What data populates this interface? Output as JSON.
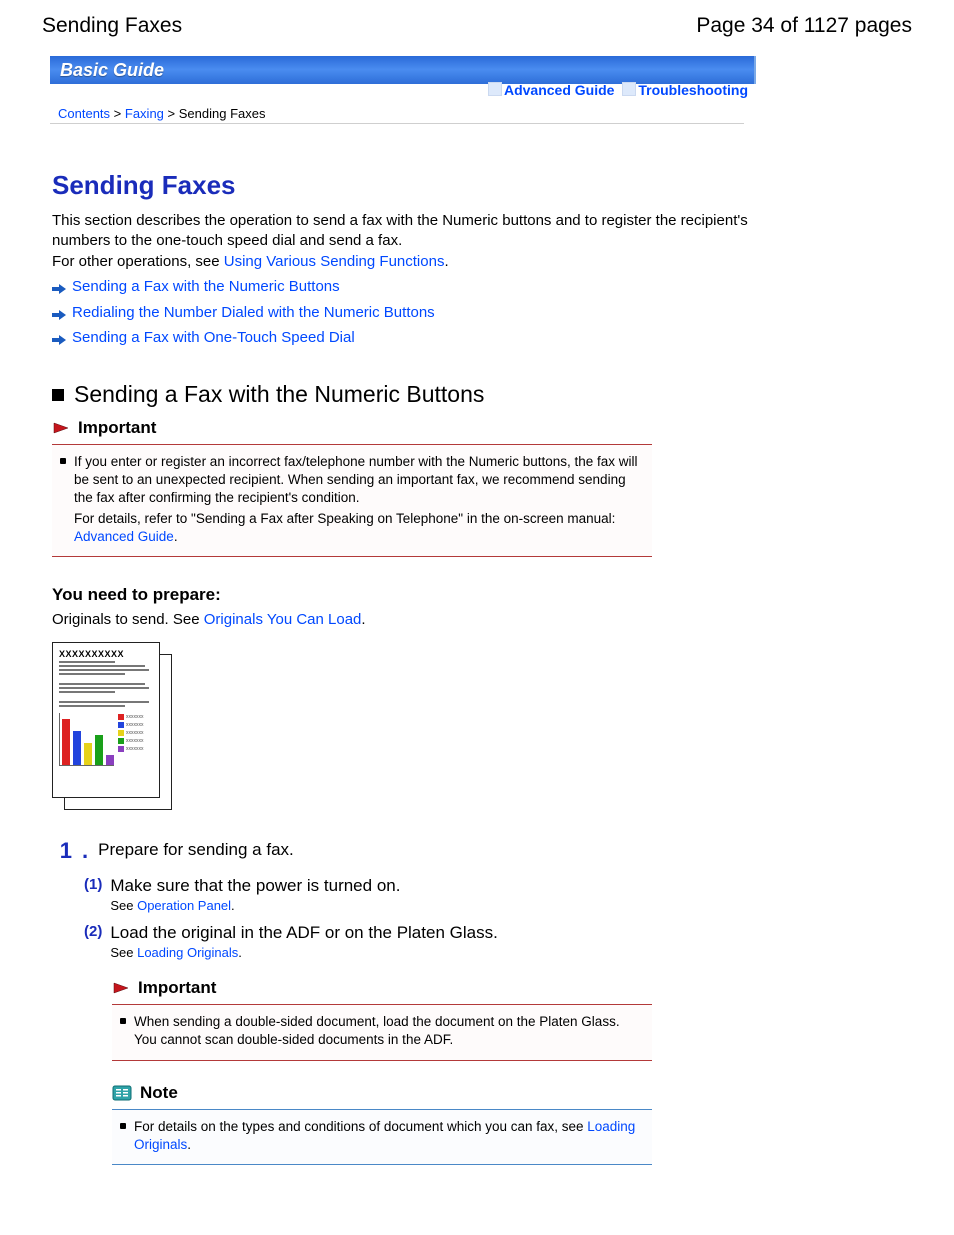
{
  "header": {
    "title_left": "Sending Faxes",
    "title_right": "Page 34 of 1127 pages"
  },
  "banner": {
    "title": "Basic Guide",
    "advanced": "Advanced Guide",
    "troubleshooting": "Troubleshooting"
  },
  "breadcrumb": {
    "contents": "Contents",
    "faxing": "Faxing",
    "current": "Sending Faxes"
  },
  "main": {
    "h1": "Sending Faxes",
    "intro1": "This section describes the operation to send a fax with the Numeric buttons and to register the recipient's numbers to the one-touch speed dial and send a fax.",
    "intro2": "For other operations, see ",
    "intro2_link": "Using Various Sending Functions",
    "intro2_after": ".",
    "links": {
      "a": "Sending a Fax with the Numeric Buttons",
      "b": "Redialing the Number Dialed with the Numeric Buttons",
      "c": "Sending a Fax with One-Touch Speed Dial"
    },
    "section_h2": "Sending a Fax with the Numeric Buttons",
    "important": {
      "label": "Important",
      "body1": "If you enter or register an incorrect fax/telephone number with the Numeric buttons, the fax will be sent to an unexpected recipient. When sending an important fax, we recommend sending the fax after confirming the recipient's condition.",
      "body2": "For details, refer to \"Sending a Fax after Speaking on Telephone\" in the on-screen manual:",
      "link": "Advanced Guide",
      "after": "."
    },
    "prepare": {
      "heading": "You need to prepare:",
      "text_before": "Originals to send. See ",
      "text_link": "Originals You Can Load",
      "text_after": ".",
      "illus_title": "XXXXXXXXXX"
    },
    "steps": {
      "n1": "1",
      "s1": "Prepare for sending a fax.",
      "sub1_n": "(1)",
      "sub1": "Make sure that the power is turned on.",
      "sub1_see": "See ",
      "sub1_link": "Operation Panel",
      "sub1_after": ".",
      "sub2_n": "(2)",
      "sub2": "Load the original in the ADF or on the Platen Glass.",
      "sub2_see": "See ",
      "sub2_link": "Loading Originals",
      "sub2_after": "."
    },
    "important2": {
      "label": "Important",
      "body": "When sending a double-sided document, load the document on the Platen Glass. You cannot scan double-sided documents in the ADF."
    },
    "note": {
      "label": "Note",
      "body_before": "For details on the types and conditions of document which you can fax, see ",
      "body_link": "Loading Originals",
      "body_after": "."
    }
  }
}
